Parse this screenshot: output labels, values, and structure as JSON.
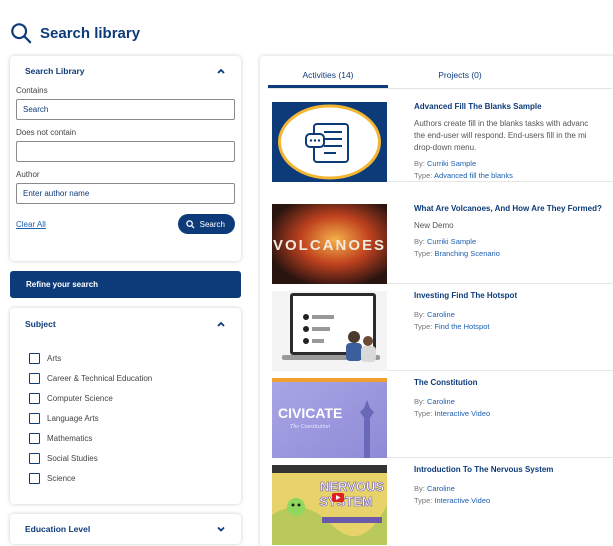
{
  "header": {
    "title": "Search library"
  },
  "search_panel": {
    "title": "Search Library",
    "contains_label": "Contains",
    "contains_placeholder": "Search",
    "not_contain_label": "Does not contain",
    "not_contain_placeholder": "",
    "author_label": "Author",
    "author_placeholder": "Enter author name",
    "clear_label": "Clear All",
    "search_label": "Search"
  },
  "refine_label": "Refine your search",
  "subject": {
    "title": "Subject",
    "items": [
      "Arts",
      "Career & Technical Education",
      "Computer Science",
      "Language Arts",
      "Mathematics",
      "Social Studies",
      "Science"
    ]
  },
  "education_level": {
    "title": "Education Level"
  },
  "tabs": [
    {
      "label": "Activities (14)",
      "active": true
    },
    {
      "label": "Projects (0)",
      "active": false
    }
  ],
  "results": [
    {
      "title": "Advanced Fill The Blanks Sample",
      "desc1": "Authors create fill in the blanks tasks with advanc",
      "desc2": "the end-user will respond. End-users fill in the mi",
      "desc3": "drop-down menu.",
      "by_prefix": "By:",
      "by": "Curriki Sample",
      "type_prefix": "Type:",
      "type": "Advanced fill the blanks"
    },
    {
      "title": "What Are Volcanoes, And How Are They Formed?",
      "desc1": "New Demo",
      "by_prefix": "By:",
      "by": "Curriki Sample",
      "type_prefix": "Type:",
      "type": "Branching Scenario",
      "thumb_text": "VOLCANOES"
    },
    {
      "title": "Investing Find The Hotspot",
      "by_prefix": "By:",
      "by": "Caroline",
      "type_prefix": "Type:",
      "type": "Find the Hotspot"
    },
    {
      "title": "The Constitution",
      "by_prefix": "By:",
      "by": "Caroline",
      "type_prefix": "Type:",
      "type": "Interactive Video",
      "thumb_text": "CIVICATE",
      "thumb_sub": "The Constitution"
    },
    {
      "title": "Introduction To The Nervous System",
      "by_prefix": "By:",
      "by": "Caroline",
      "type_prefix": "Type:",
      "type": "Interactive Video",
      "thumb_text1": "NERVOUS",
      "thumb_text2": "SYSTEM"
    }
  ],
  "colors": {
    "primary": "#0d3b7a",
    "link": "#1c5fb0",
    "text": "#444444"
  }
}
